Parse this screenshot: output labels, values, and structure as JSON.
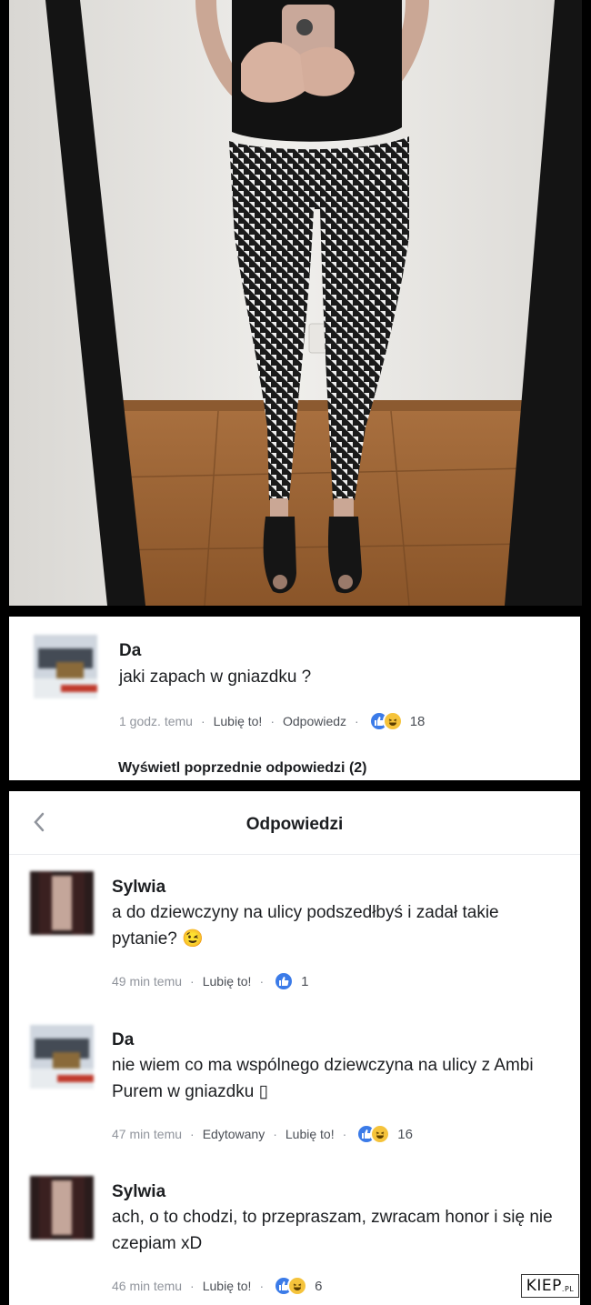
{
  "colors": {
    "like_blue": "#3b7be8",
    "haha_yellow": "#f5c33b",
    "meta_gray": "#90949c"
  },
  "top_comment": {
    "author": "Da",
    "text": "jaki zapach w gniazdku ?",
    "time": "1 godz. temu",
    "like": "Lubię to!",
    "reply": "Odpowiedz",
    "reactions": [
      "like-icon",
      "haha-icon"
    ],
    "count": "18"
  },
  "previous_replies": "Wyświetl poprzednie odpowiedzi (2)",
  "replies_header": {
    "title": "Odpowiedzi",
    "back_icon": "chevron-left-icon"
  },
  "replies": [
    {
      "author": "Sylwia",
      "text": "a do dziewczyny na ulicy podszedłbyś i zadał takie pytanie? 😉",
      "time": "49 min temu",
      "like": "Lubię to!",
      "reactions": [
        "like-icon"
      ],
      "count": "1"
    },
    {
      "author": "Da",
      "text": "nie wiem co ma wspólnego dziewczyna na ulicy z Ambi Purem w gniazdku ▯",
      "time": "47 min temu",
      "edited": "Edytowany",
      "like": "Lubię to!",
      "reactions": [
        "like-icon",
        "haha-icon"
      ],
      "count": "16"
    },
    {
      "author": "Sylwia",
      "text": "ach, o to chodzi, to przepraszam, zwracam honor i się nie czepiam xD",
      "time": "46 min temu",
      "like": "Lubię to!",
      "reactions": [
        "like-icon",
        "haha-icon"
      ],
      "count": "6"
    }
  ],
  "watermark": {
    "main": "KIEP",
    "suffix": ".PL"
  }
}
